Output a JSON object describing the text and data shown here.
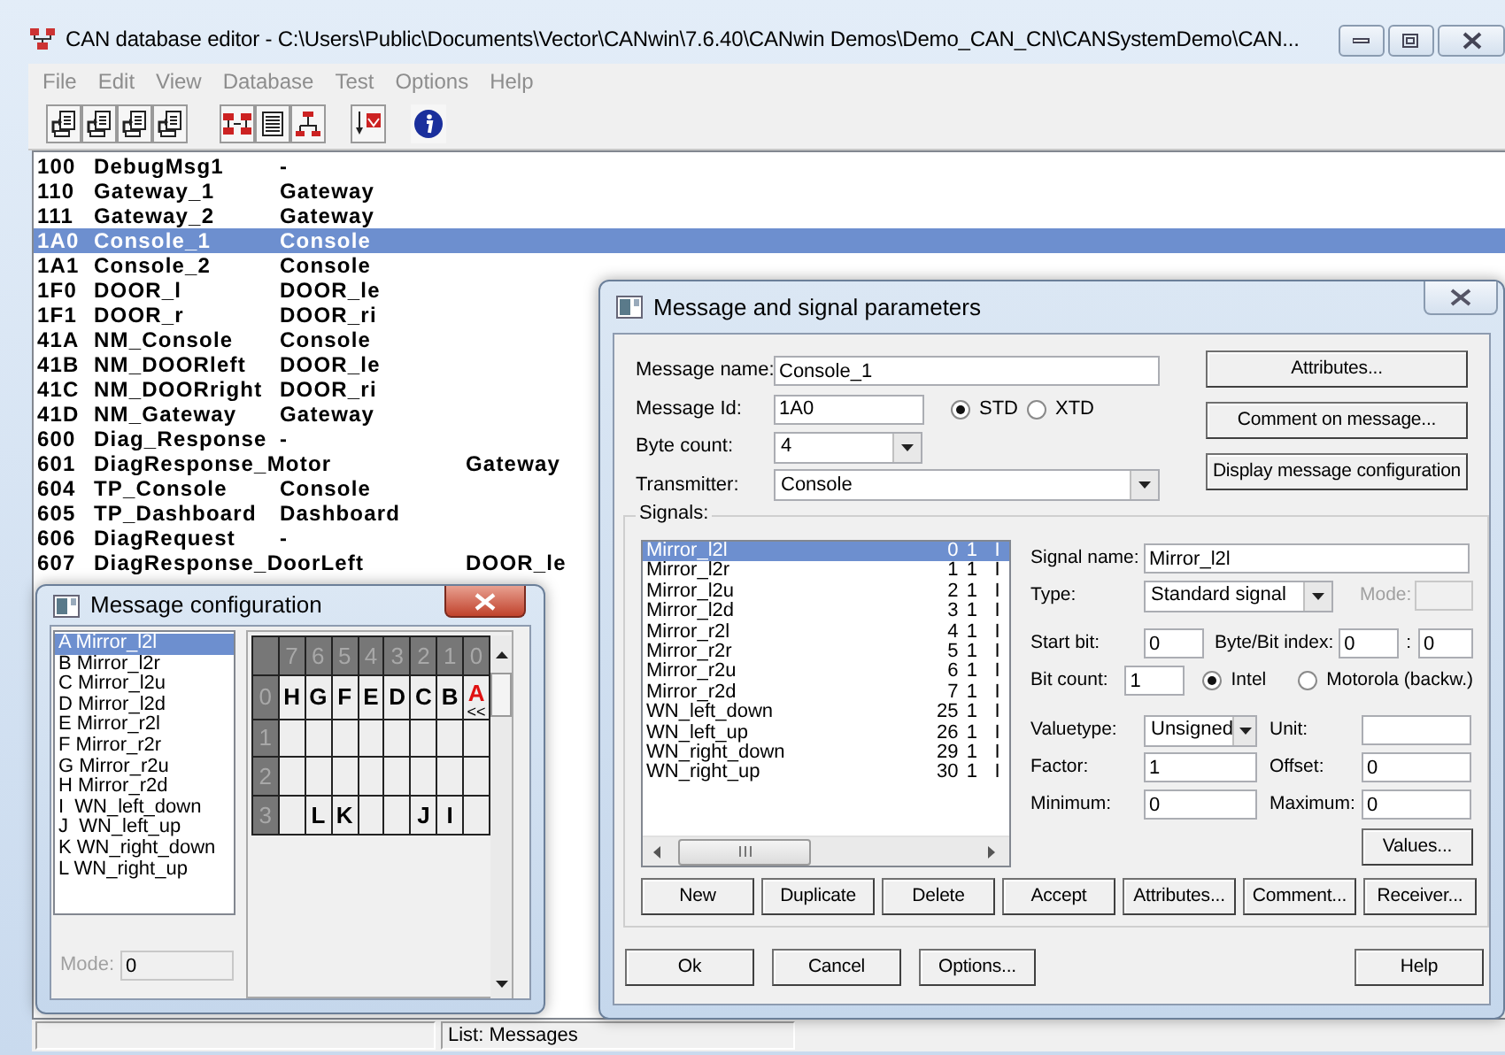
{
  "window": {
    "title": "CAN database editor - C:\\Users\\Public\\Documents\\Vector\\CANwin\\7.6.40\\CANwin Demos\\Demo_CAN_CN\\CANSystemDemo\\CAN..."
  },
  "menu": [
    {
      "label": "File",
      "disabled": true
    },
    {
      "label": "Edit",
      "disabled": true
    },
    {
      "label": "View",
      "disabled": true
    },
    {
      "label": "Database",
      "disabled": true
    },
    {
      "label": "Test",
      "disabled": true
    },
    {
      "label": "Options",
      "disabled": true
    },
    {
      "label": "Help",
      "disabled": true
    }
  ],
  "messages": [
    {
      "id": "100",
      "name": "DebugMsg1",
      "node": "-",
      "selected": false
    },
    {
      "id": "110",
      "name": "Gateway_1",
      "node": "Gateway",
      "selected": false
    },
    {
      "id": "111",
      "name": "Gateway_2",
      "node": "Gateway",
      "selected": false
    },
    {
      "id": "1A0",
      "name": "Console_1",
      "node": "Console",
      "selected": true
    },
    {
      "id": "1A1",
      "name": "Console_2",
      "node": "Console",
      "selected": false
    },
    {
      "id": "1F0",
      "name": "DOOR_l",
      "node": "DOOR_le",
      "selected": false
    },
    {
      "id": "1F1",
      "name": "DOOR_r",
      "node": "DOOR_ri",
      "selected": false
    },
    {
      "id": "41A",
      "name": "NM_Console",
      "node": "Console",
      "selected": false
    },
    {
      "id": "41B",
      "name": "NM_DOORleft",
      "node": "DOOR_le",
      "selected": false
    },
    {
      "id": "41C",
      "name": "NM_DOORright",
      "node": "DOOR_ri",
      "selected": false
    },
    {
      "id": "41D",
      "name": "NM_Gateway",
      "node": "Gateway",
      "selected": false
    },
    {
      "id": "600",
      "name": "Diag_Response",
      "node": "-",
      "selected": false
    },
    {
      "id": "601",
      "name": "DiagResponse_Motor",
      "node": "Gateway",
      "selected": false
    },
    {
      "id": "604",
      "name": "TP_Console",
      "node": "Console",
      "selected": false
    },
    {
      "id": "605",
      "name": "TP_Dashboard",
      "node": "Dashboard",
      "selected": false
    },
    {
      "id": "606",
      "name": "DiagRequest",
      "node": "-",
      "selected": false
    },
    {
      "id": "607",
      "name": "DiagResponse_DoorLeft",
      "node": "DOOR_le",
      "selected": false
    }
  ],
  "status_bar": {
    "list_label": "List: Messages"
  },
  "param_dialog": {
    "title": "Message and signal parameters",
    "message_name": {
      "label": "Message name:",
      "value": "Console_1"
    },
    "message_id": {
      "label": "Message Id:",
      "value": "1A0"
    },
    "id_format": [
      {
        "label": "STD",
        "selected": true
      },
      {
        "label": "XTD",
        "selected": false
      }
    ],
    "byte_count": {
      "label": "Byte count:",
      "value": "4"
    },
    "transmitter": {
      "label": "Transmitter:",
      "value": "Console"
    },
    "side_buttons": [
      "Attributes...",
      "Comment on message...",
      "Display message configuration"
    ],
    "signals": {
      "label": "Signals:",
      "rows": [
        {
          "name": "Mirror_l2l",
          "start_bit": "0",
          "length": "1",
          "order": "I",
          "selected": true
        },
        {
          "name": "Mirror_l2r",
          "start_bit": "1",
          "length": "1",
          "order": "I",
          "selected": false
        },
        {
          "name": "Mirror_l2u",
          "start_bit": "2",
          "length": "1",
          "order": "I",
          "selected": false
        },
        {
          "name": "Mirror_l2d",
          "start_bit": "3",
          "length": "1",
          "order": "I",
          "selected": false
        },
        {
          "name": "Mirror_r2l",
          "start_bit": "4",
          "length": "1",
          "order": "I",
          "selected": false
        },
        {
          "name": "Mirror_r2r",
          "start_bit": "5",
          "length": "1",
          "order": "I",
          "selected": false
        },
        {
          "name": "Mirror_r2u",
          "start_bit": "6",
          "length": "1",
          "order": "I",
          "selected": false
        },
        {
          "name": "Mirror_r2d",
          "start_bit": "7",
          "length": "1",
          "order": "I",
          "selected": false
        },
        {
          "name": "WN_left_down",
          "start_bit": "25",
          "length": "1",
          "order": "I",
          "selected": false
        },
        {
          "name": "WN_left_up",
          "start_bit": "26",
          "length": "1",
          "order": "I",
          "selected": false
        },
        {
          "name": "WN_right_down",
          "start_bit": "29",
          "length": "1",
          "order": "I",
          "selected": false
        },
        {
          "name": "WN_right_up",
          "start_bit": "30",
          "length": "1",
          "order": "I",
          "selected": false
        }
      ],
      "signal_name": {
        "label": "Signal name:",
        "value": "Mirror_l2l"
      },
      "type": {
        "label": "Type:",
        "value": "Standard signal"
      },
      "mode": {
        "label": "Mode:",
        "disabled": true
      },
      "start_bit": {
        "label": "Start bit:",
        "value": "0"
      },
      "byte_bit_index": {
        "label": "Byte/Bit index:",
        "byte": "0",
        "separator": ":",
        "bit": "0"
      },
      "bit_count": {
        "label": "Bit count:",
        "value": "1"
      },
      "byte_order": [
        {
          "label": "Intel",
          "selected": true
        },
        {
          "label": "Motorola (backw.)",
          "selected": false
        }
      ],
      "valuetype": {
        "label": "Valuetype:",
        "value": "Unsigned"
      },
      "unit": {
        "label": "Unit:"
      },
      "factor": {
        "label": "Factor:",
        "value": "1"
      },
      "offset": {
        "label": "Offset:",
        "value": "0"
      },
      "minimum": {
        "label": "Minimum:",
        "value": "0"
      },
      "maximum": {
        "label": "Maximum:",
        "value": "0"
      },
      "values_button": "Values...",
      "buttons": [
        "New",
        "Duplicate",
        "Delete",
        "Accept",
        "Attributes...",
        "Comment...",
        "Receiver..."
      ]
    },
    "buttons": [
      "Ok",
      "Cancel",
      "Options...",
      "Help"
    ]
  },
  "config_dialog": {
    "title": "Message configuration",
    "signals": [
      {
        "label": "A Mirror_l2l",
        "selected": true
      },
      {
        "label": "B Mirror_l2r",
        "selected": false
      },
      {
        "label": "C Mirror_l2u",
        "selected": false
      },
      {
        "label": "D Mirror_l2d",
        "selected": false
      },
      {
        "label": "E Mirror_r2l",
        "selected": false
      },
      {
        "label": "F Mirror_r2r",
        "selected": false
      },
      {
        "label": "G Mirror_r2u",
        "selected": false
      },
      {
        "label": "H Mirror_r2d",
        "selected": false
      },
      {
        "label": "I  WN_left_down",
        "selected": false
      },
      {
        "label": "J  WN_left_up",
        "selected": false
      },
      {
        "label": "K WN_right_down",
        "selected": false
      },
      {
        "label": "L WN_right_up",
        "selected": false
      }
    ],
    "mode": {
      "label": "Mode:",
      "value": "0",
      "disabled": true
    },
    "layout": {
      "bit_headers": [
        "7",
        "6",
        "5",
        "4",
        "3",
        "2",
        "1",
        "0"
      ],
      "rows": [
        {
          "label": "0",
          "cells": [
            {
              "text": "H",
              "selected": false
            },
            {
              "text": "G",
              "selected": false
            },
            {
              "text": "F",
              "selected": false
            },
            {
              "text": "E",
              "selected": false
            },
            {
              "text": "D",
              "selected": false
            },
            {
              "text": "C",
              "selected": false
            },
            {
              "text": "B",
              "selected": false
            },
            {
              "text": "A",
              "selected": true,
              "marker": "<<"
            }
          ]
        },
        {
          "label": "1",
          "cells": [
            null,
            null,
            null,
            null,
            null,
            null,
            null,
            null
          ]
        },
        {
          "label": "2",
          "cells": [
            null,
            null,
            null,
            null,
            null,
            null,
            null,
            null
          ]
        },
        {
          "label": "3",
          "cells": [
            null,
            {
              "text": "L",
              "selected": false
            },
            {
              "text": "K",
              "selected": false
            },
            null,
            null,
            {
              "text": "J",
              "selected": false
            },
            {
              "text": "I",
              "selected": false
            },
            null
          ]
        }
      ]
    }
  }
}
